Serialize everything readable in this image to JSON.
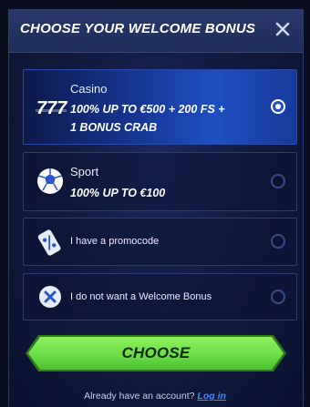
{
  "header": {
    "title": "CHOOSE YOUR WELCOME BONUS",
    "close_icon": "close-icon"
  },
  "options": [
    {
      "label": "Casino",
      "description_line1": "100% UP TO €500 + 200 FS +",
      "description_line2": "1 BONUS CRAB",
      "icon": "slot-777-icon",
      "selected": true
    },
    {
      "label": "Sport",
      "description_line1": "100% UP TO €100",
      "icon": "soccer-ball-icon",
      "selected": false
    },
    {
      "label": "I have a promocode",
      "icon": "promo-ticket-icon",
      "selected": false
    },
    {
      "label": "I do not want a Welcome Bonus",
      "icon": "no-bonus-icon",
      "selected": false
    }
  ],
  "choose_button": {
    "label": "CHOOSE"
  },
  "footer": {
    "text": "Already have an account?",
    "login_label": "Log in"
  },
  "colors": {
    "accent_green": "#6ee04a",
    "selected_blue": "#1f4fc4",
    "link_blue": "#3d8bff",
    "background": "#0a0e1f"
  }
}
